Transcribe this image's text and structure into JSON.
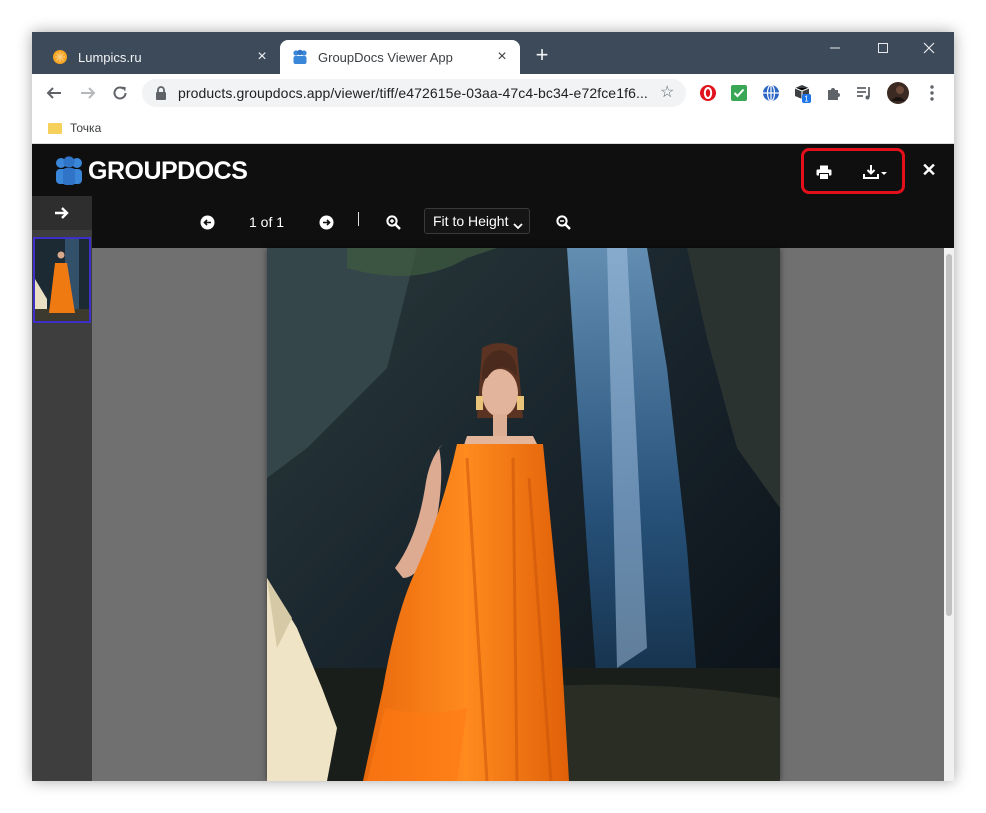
{
  "browser": {
    "tabs": [
      {
        "title": "Lumpics.ru",
        "active": false,
        "favicon": "orange-circle-icon"
      },
      {
        "title": "GroupDocs Viewer App",
        "active": true,
        "favicon": "groupdocs-icon"
      }
    ],
    "new_tab_label": "+",
    "address": "products.groupdocs.app/viewer/tiff/e472615e-03aa-47c4-bc34-e72fce1f6...",
    "bookmarks": [
      {
        "label": "Точка"
      }
    ],
    "extension_badge": "1"
  },
  "app": {
    "logo_text": "GROUPDOCS",
    "page_counter": "1 of 1",
    "zoom_value": "Fit to Height",
    "colors": {
      "header_bg": "#0f0f0f",
      "highlight_border": "#e3101b",
      "sidebar_bg": "#3e3e3e",
      "doc_bg": "#707070",
      "dress": "#f07a12"
    }
  }
}
